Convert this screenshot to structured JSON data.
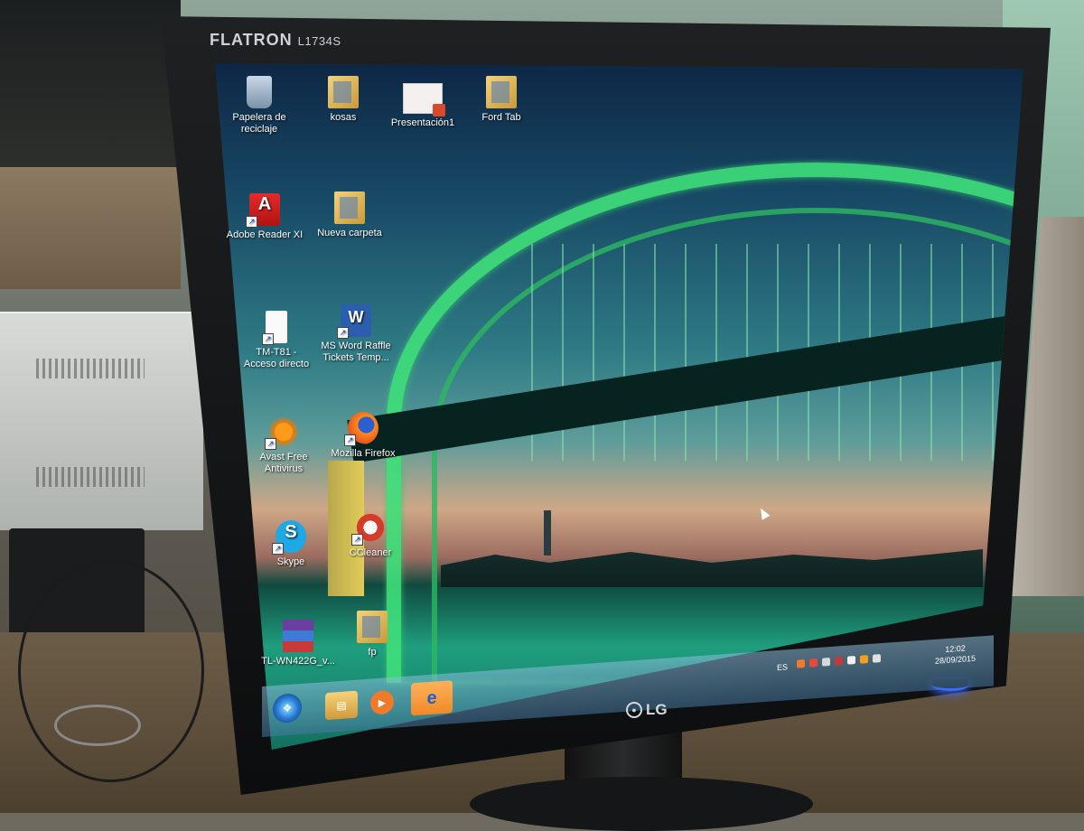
{
  "monitor": {
    "brand": "FLATRON",
    "model": "L1734S",
    "manufacturer": "LG"
  },
  "desktop": {
    "icons": [
      {
        "label": "Papelera de reciclaje",
        "icon": "recycle-bin-icon"
      },
      {
        "label": "kosas",
        "icon": "folder-icon"
      },
      {
        "label": "Presentación1",
        "icon": "powerpoint-file-icon"
      },
      {
        "label": "Ford Tab",
        "icon": "folder-icon"
      },
      {
        "label": "Adobe Reader XI",
        "icon": "adobe-reader-icon"
      },
      {
        "label": "Nueva carpeta",
        "icon": "folder-icon"
      },
      {
        "label": "TM-T81 - Acceso directo",
        "icon": "file-shortcut-icon"
      },
      {
        "label": "MS Word Raffle Tickets Temp...",
        "icon": "word-icon"
      },
      {
        "label": "Avast Free Antivirus",
        "icon": "avast-icon"
      },
      {
        "label": "Mozilla Firefox",
        "icon": "firefox-icon"
      },
      {
        "label": "Skype",
        "icon": "skype-icon"
      },
      {
        "label": "CCleaner",
        "icon": "ccleaner-icon"
      },
      {
        "label": "TL-WN422G_v...",
        "icon": "winrar-icon"
      },
      {
        "label": "fp",
        "icon": "folder-icon"
      }
    ]
  },
  "taskbar": {
    "pinned": [
      "start-button",
      "windows-explorer",
      "media-player",
      "internet-explorer"
    ],
    "tray": {
      "language": "ES",
      "time": "12:02",
      "date": "28/09/2015"
    }
  },
  "colors": {
    "bridge_green": "#3fe07a",
    "power_led": "#3e6bff",
    "taskbar": "#6fa0c8"
  }
}
